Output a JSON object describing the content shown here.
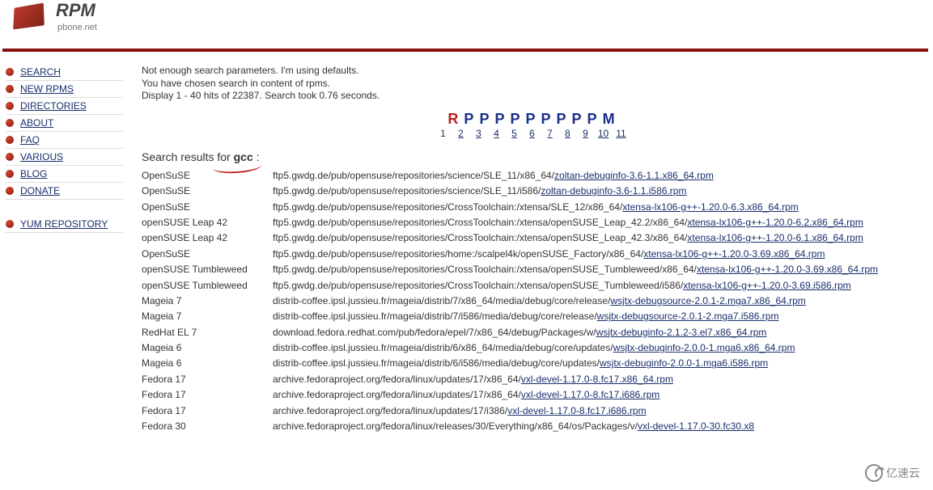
{
  "logo": {
    "main": "RPM",
    "sub": "pbone.net"
  },
  "nav": {
    "main": [
      {
        "label": "SEARCH"
      },
      {
        "label": "NEW RPMS"
      },
      {
        "label": "DIRECTORIES"
      },
      {
        "label": "ABOUT"
      },
      {
        "label": "FAQ"
      },
      {
        "label": "VARIOUS"
      },
      {
        "label": "BLOG"
      },
      {
        "label": "DONATE"
      }
    ],
    "extra": [
      {
        "label": "YUM REPOSITORY"
      }
    ]
  },
  "message": {
    "line1": "Not enough search parameters. I'm using defaults.",
    "line2": "You have chosen search in content of rpms.",
    "line3": "Display 1 - 40 hits of 22387. Search took 0.76 seconds."
  },
  "pager": {
    "letters": [
      "R",
      "P",
      "P",
      "P",
      "P",
      "P",
      "P",
      "P",
      "P",
      "P",
      "M"
    ],
    "pages": [
      "1",
      "2",
      "3",
      "4",
      "5",
      "6",
      "7",
      "8",
      "9",
      "10",
      "11"
    ]
  },
  "search": {
    "label_pre": "Search results for ",
    "term": "gcc",
    "label_post": " :"
  },
  "results": [
    {
      "distro": "OpenSuSE",
      "path": "ftp5.gwdg.de/pub/opensuse/repositories/science/SLE_11/x86_64/",
      "file": "zoltan-debuginfo-3.6-1.1.x86_64.rpm"
    },
    {
      "distro": "OpenSuSE",
      "path": "ftp5.gwdg.de/pub/opensuse/repositories/science/SLE_11/i586/",
      "file": "zoltan-debuginfo-3.6-1.1.i586.rpm"
    },
    {
      "distro": "OpenSuSE",
      "path": "ftp5.gwdg.de/pub/opensuse/repositories/CrossToolchain:/xtensa/SLE_12/x86_64/",
      "file": "xtensa-lx106-g++-1.20.0-6.3.x86_64.rpm"
    },
    {
      "distro": "openSUSE Leap 42",
      "path": "ftp5.gwdg.de/pub/opensuse/repositories/CrossToolchain:/xtensa/openSUSE_Leap_42.2/x86_64/",
      "file": "xtensa-lx106-g++-1.20.0-6.2.x86_64.rpm"
    },
    {
      "distro": "openSUSE Leap 42",
      "path": "ftp5.gwdg.de/pub/opensuse/repositories/CrossToolchain:/xtensa/openSUSE_Leap_42.3/x86_64/",
      "file": "xtensa-lx106-g++-1.20.0-6.1.x86_64.rpm"
    },
    {
      "distro": "OpenSuSE",
      "path": "ftp5.gwdg.de/pub/opensuse/repositories/home:/scalpel4k/openSUSE_Factory/x86_64/",
      "file": "xtensa-lx106-g++-1.20.0-3.69.x86_64.rpm"
    },
    {
      "distro": "openSUSE Tumbleweed",
      "path": "ftp5.gwdg.de/pub/opensuse/repositories/CrossToolchain:/xtensa/openSUSE_Tumbleweed/x86_64/",
      "file": "xtensa-lx106-g++-1.20.0-3.69.x86_64.rpm"
    },
    {
      "distro": "openSUSE Tumbleweed",
      "path": "ftp5.gwdg.de/pub/opensuse/repositories/CrossToolchain:/xtensa/openSUSE_Tumbleweed/i586/",
      "file": "xtensa-lx106-g++-1.20.0-3.69.i586.rpm"
    },
    {
      "distro": "Mageia 7",
      "path": "distrib-coffee.ipsl.jussieu.fr/mageia/distrib/7/x86_64/media/debug/core/release/",
      "file": "wsjtx-debugsource-2.0.1-2.mga7.x86_64.rpm"
    },
    {
      "distro": "Mageia 7",
      "path": "distrib-coffee.ipsl.jussieu.fr/mageia/distrib/7/i586/media/debug/core/release/",
      "file": "wsjtx-debugsource-2.0.1-2.mga7.i586.rpm"
    },
    {
      "distro": "RedHat EL 7",
      "path": "download.fedora.redhat.com/pub/fedora/epel/7/x86_64/debug/Packages/w/",
      "file": "wsjtx-debuginfo-2.1.2-3.el7.x86_64.rpm"
    },
    {
      "distro": "Mageia 6",
      "path": "distrib-coffee.ipsl.jussieu.fr/mageia/distrib/6/x86_64/media/debug/core/updates/",
      "file": "wsjtx-debuginfo-2.0.0-1.mga6.x86_64.rpm"
    },
    {
      "distro": "Mageia 6",
      "path": "distrib-coffee.ipsl.jussieu.fr/mageia/distrib/6/i586/media/debug/core/updates/",
      "file": "wsjtx-debuginfo-2.0.0-1.mga6.i586.rpm"
    },
    {
      "distro": "Fedora 17",
      "path": "archive.fedoraproject.org/fedora/linux/updates/17/x86_64/",
      "file": "vxl-devel-1.17.0-8.fc17.x86_64.rpm"
    },
    {
      "distro": "Fedora 17",
      "path": "archive.fedoraproject.org/fedora/linux/updates/17/x86_64/",
      "file": "vxl-devel-1.17.0-8.fc17.i686.rpm"
    },
    {
      "distro": "Fedora 17",
      "path": "archive.fedoraproject.org/fedora/linux/updates/17/i386/",
      "file": "vxl-devel-1.17.0-8.fc17.i686.rpm"
    },
    {
      "distro": "Fedora 30",
      "path": "archive.fedoraproject.org/fedora/linux/releases/30/Everything/x86_64/os/Packages/v/",
      "file": "vxl-devel-1.17.0-30.fc30.x8"
    }
  ],
  "watermark": "亿速云"
}
